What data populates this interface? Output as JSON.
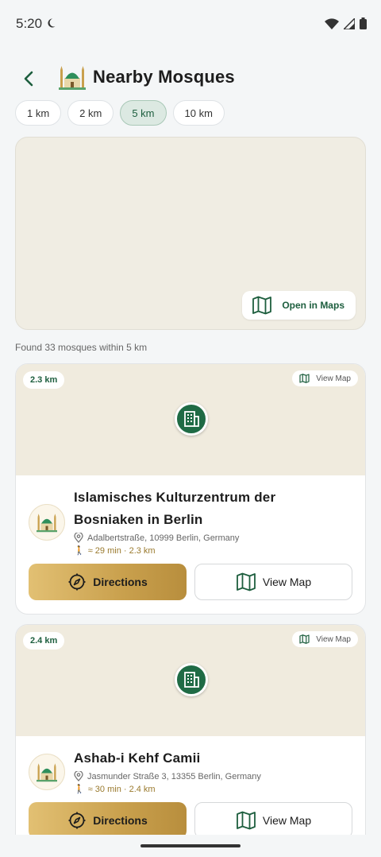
{
  "status": {
    "time": "5:20"
  },
  "header": {
    "title": "Nearby Mosques"
  },
  "chips": [
    {
      "label": "1 km",
      "active": false
    },
    {
      "label": "2 km",
      "active": false
    },
    {
      "label": "5 km",
      "active": true
    },
    {
      "label": "10 km",
      "active": false
    }
  ],
  "map": {
    "open_label": "Open in Maps"
  },
  "results": {
    "summary": "Found 33 mosques within 5 km"
  },
  "mosques": [
    {
      "distance": "2.3 km",
      "view_map_small": "View Map",
      "name_line1": "Islamisches Kulturzentrum der",
      "name_line2": "Bosniaken in Berlin",
      "address": "Adalbertstraße, 10999 Berlin, Germany",
      "walk": "≈ 29 min · 2.3 km",
      "directions_label": "Directions",
      "view_map_label": "View Map"
    },
    {
      "distance": "2.4 km",
      "view_map_small": "View Map",
      "name_line1": "Ashab-i Kehf Camii",
      "address": "Jasmunder Straße 3, 13355 Berlin, Germany",
      "walk": "≈ 30 min · 2.4 km",
      "directions_label": "Directions",
      "view_map_label": "View Map"
    }
  ],
  "colors": {
    "primary_green": "#1d5e3e",
    "gold": "#c9a04d",
    "map_bg": "#f0ede3"
  }
}
